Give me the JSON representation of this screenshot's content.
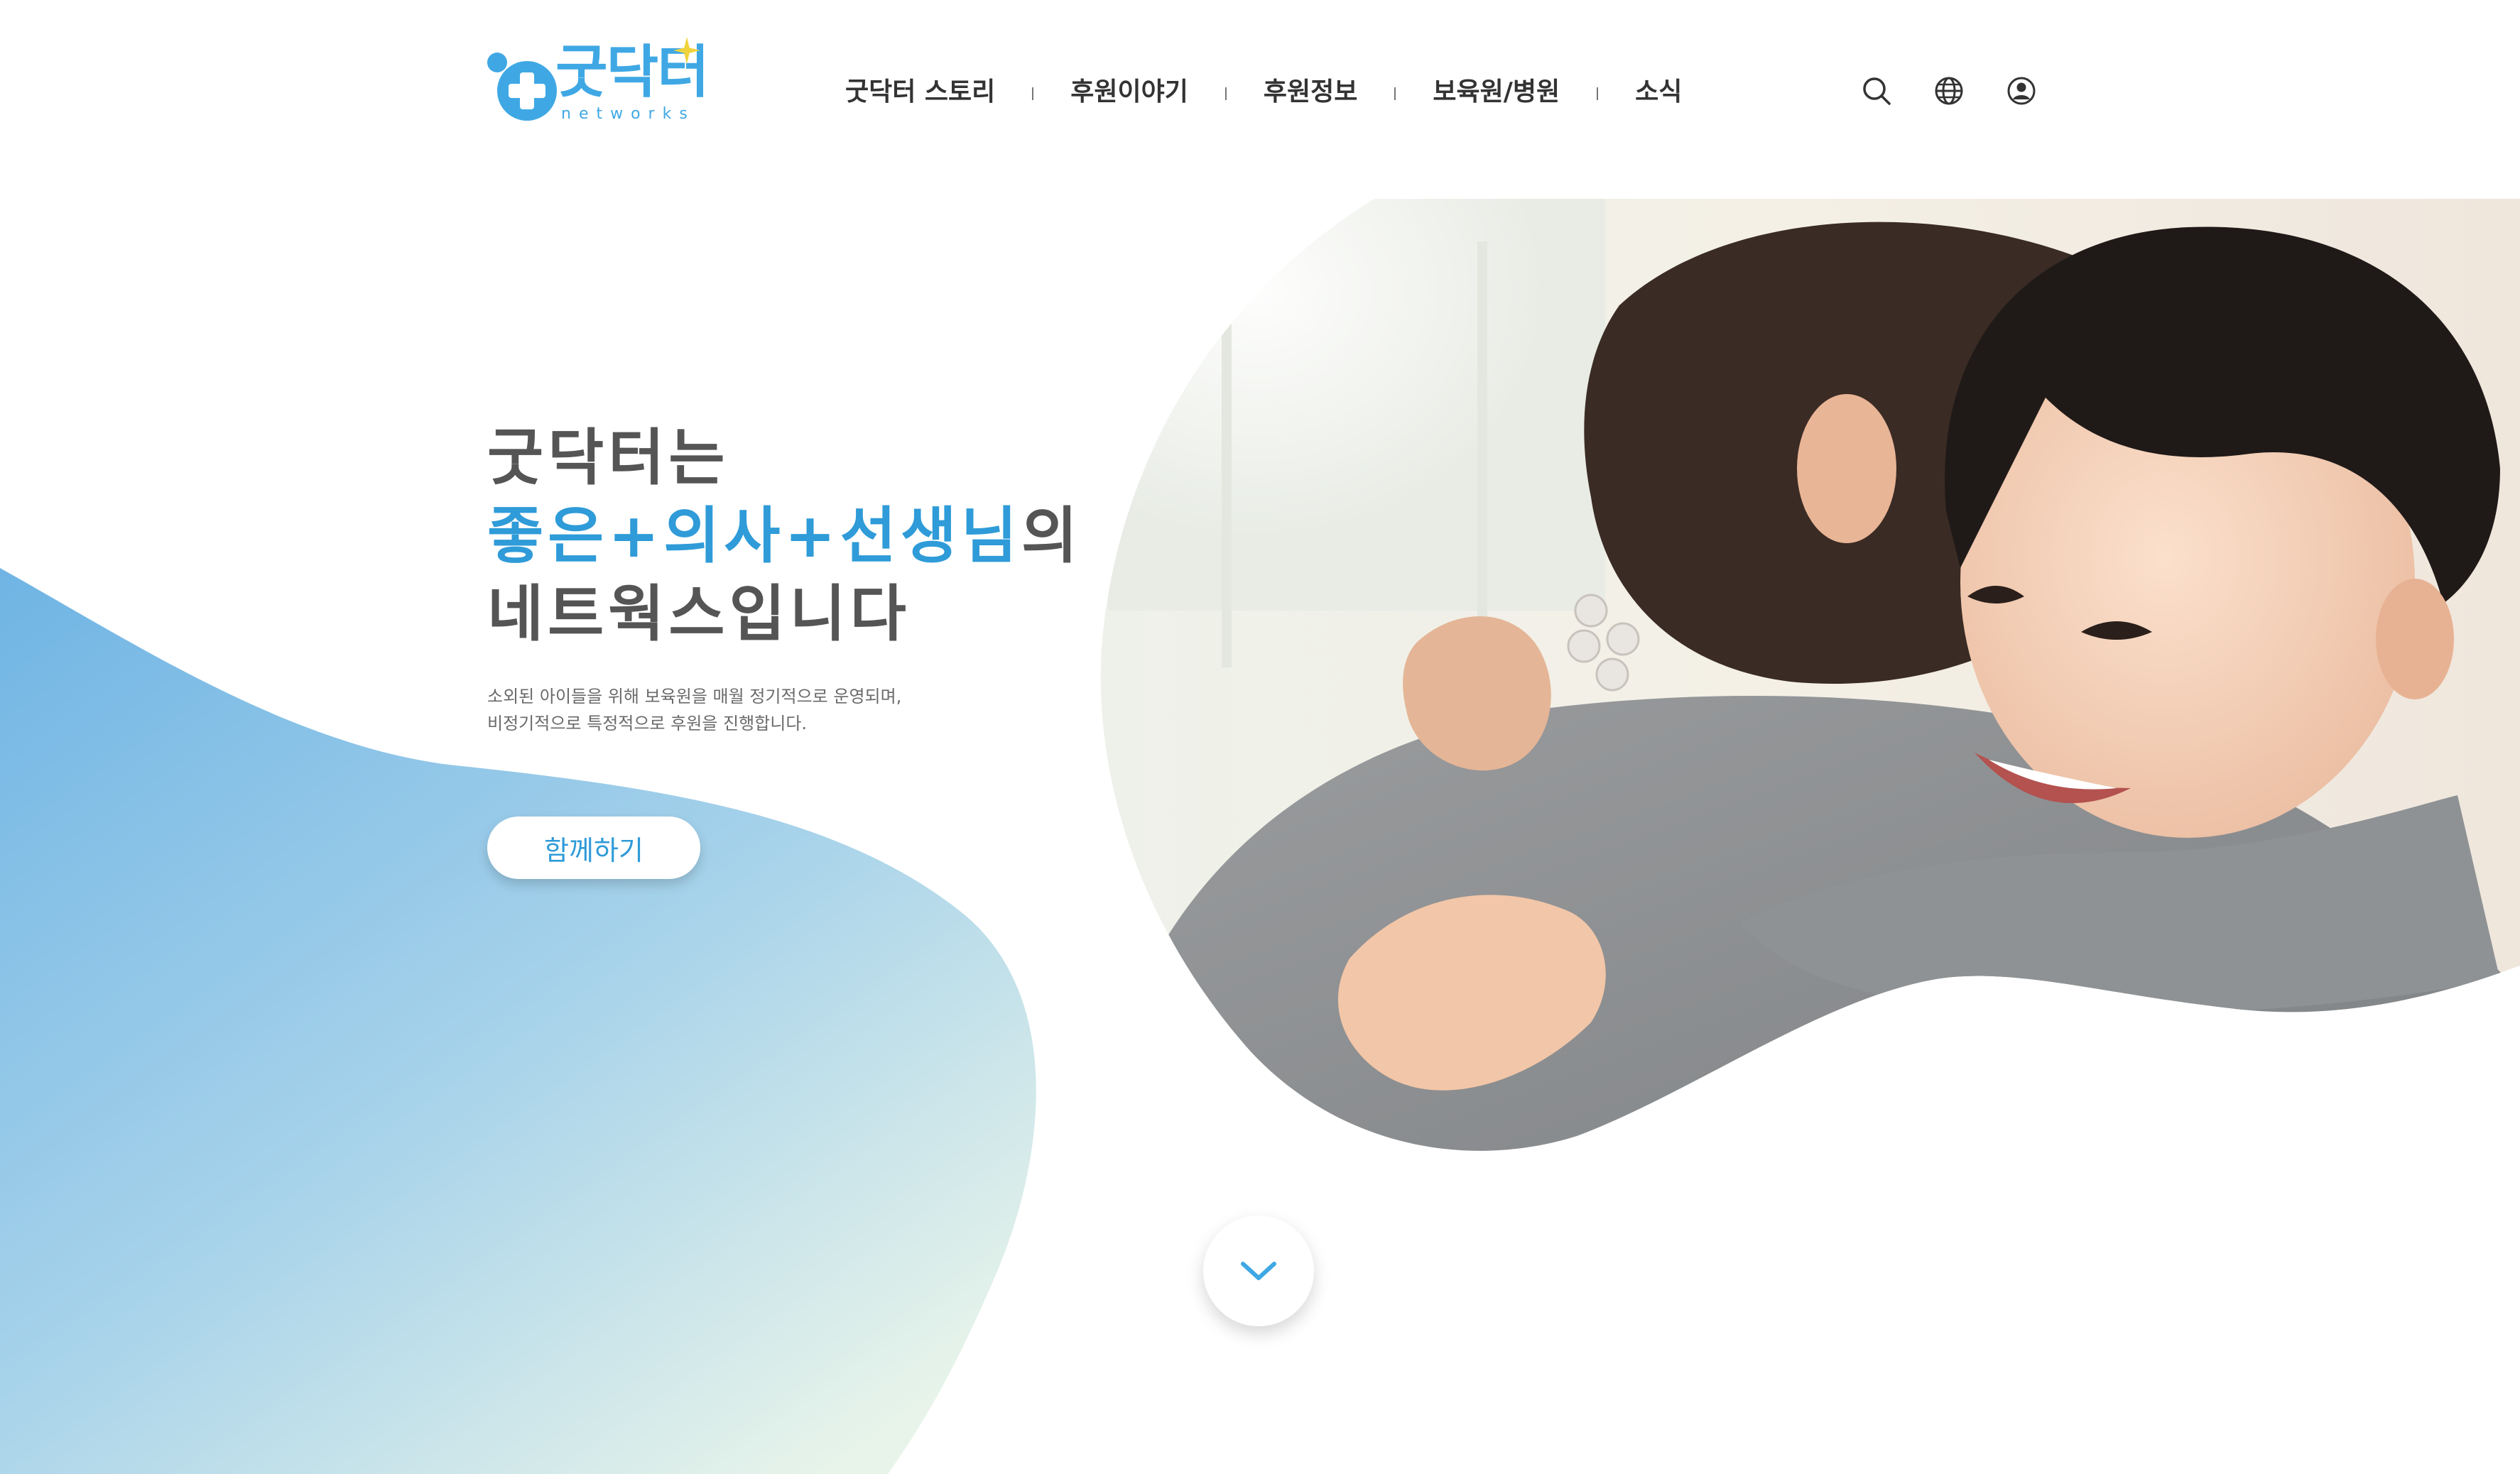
{
  "brand": {
    "name": "굿닥터",
    "sub": "networks",
    "color": "#3fa8e4"
  },
  "nav": {
    "items": [
      {
        "label": "굿닥터 스토리"
      },
      {
        "label": "후원이야기"
      },
      {
        "label": "후원정보"
      },
      {
        "label": "보육원/병원"
      },
      {
        "label": "소식"
      }
    ]
  },
  "utilities": [
    {
      "icon": "search-icon"
    },
    {
      "icon": "globe-icon"
    },
    {
      "icon": "user-icon"
    }
  ],
  "hero": {
    "line1": "굿닥터는",
    "line2_accent": "좋은+의사+선생님",
    "line2_rest": "의",
    "line3": "네트웍스입니다",
    "desc_line1": "소외된 아이들을 위해 보육원을 매월 정기적으로 운영되며,",
    "desc_line2": "비정기적으로 특정적으로 후원을 진행합니다.",
    "cta_label": "함께하기",
    "scroll_icon": "chevron-down-icon"
  },
  "colors": {
    "accent": "#2f9bd8",
    "blob_start": "#7cbde6",
    "blob_end": "#e6f3ec",
    "text_dark": "#555555"
  }
}
